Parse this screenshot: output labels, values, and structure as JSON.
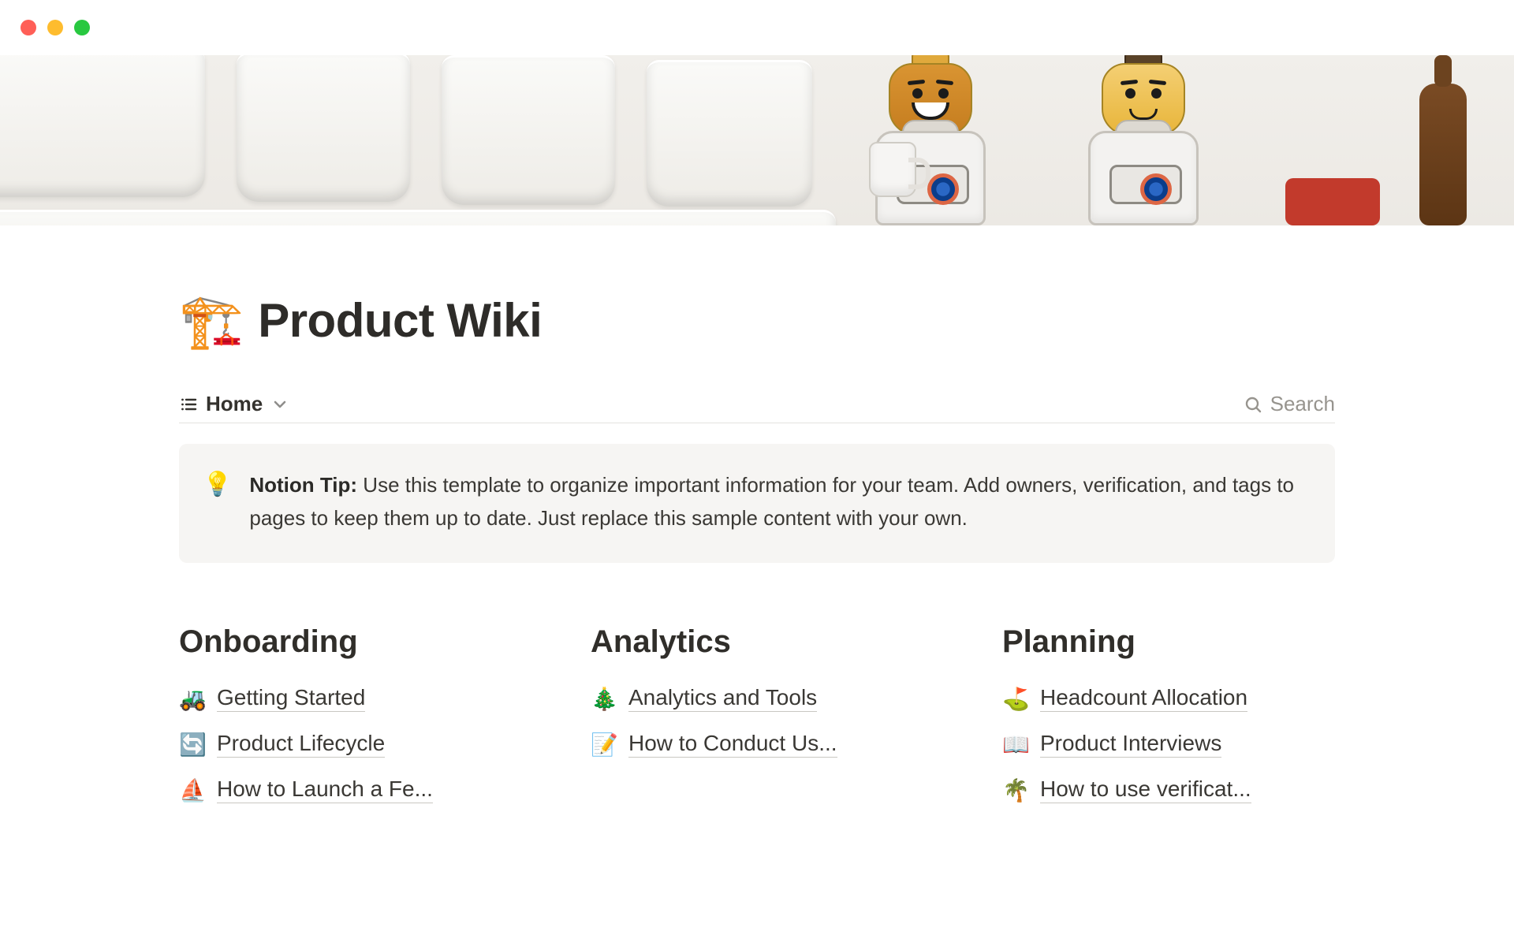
{
  "page": {
    "emoji": "🏗️",
    "title": "Product Wiki"
  },
  "viewbar": {
    "active_view": "Home",
    "search_label": "Search"
  },
  "callout": {
    "icon": "💡",
    "title": "Notion Tip:",
    "body": "Use this template to organize important information for your team. Add owners, verification, and tags to pages to keep them up to date. Just replace this sample content with your own."
  },
  "columns": [
    {
      "heading": "Onboarding",
      "links": [
        {
          "emoji": "🚜",
          "label": "Getting Started"
        },
        {
          "emoji": "🔄",
          "label": "Product Lifecycle"
        },
        {
          "emoji": "⛵",
          "label": "How to Launch a Fe..."
        }
      ]
    },
    {
      "heading": "Analytics",
      "links": [
        {
          "emoji": "🎄",
          "label": "Analytics and Tools"
        },
        {
          "emoji": "📝",
          "label": "How to Conduct Us..."
        }
      ]
    },
    {
      "heading": "Planning",
      "links": [
        {
          "emoji": "⛳",
          "label": "Headcount Allocation"
        },
        {
          "emoji": "📖",
          "label": "Product Interviews"
        },
        {
          "emoji": "🌴",
          "label": "How to use verificat..."
        }
      ]
    }
  ]
}
